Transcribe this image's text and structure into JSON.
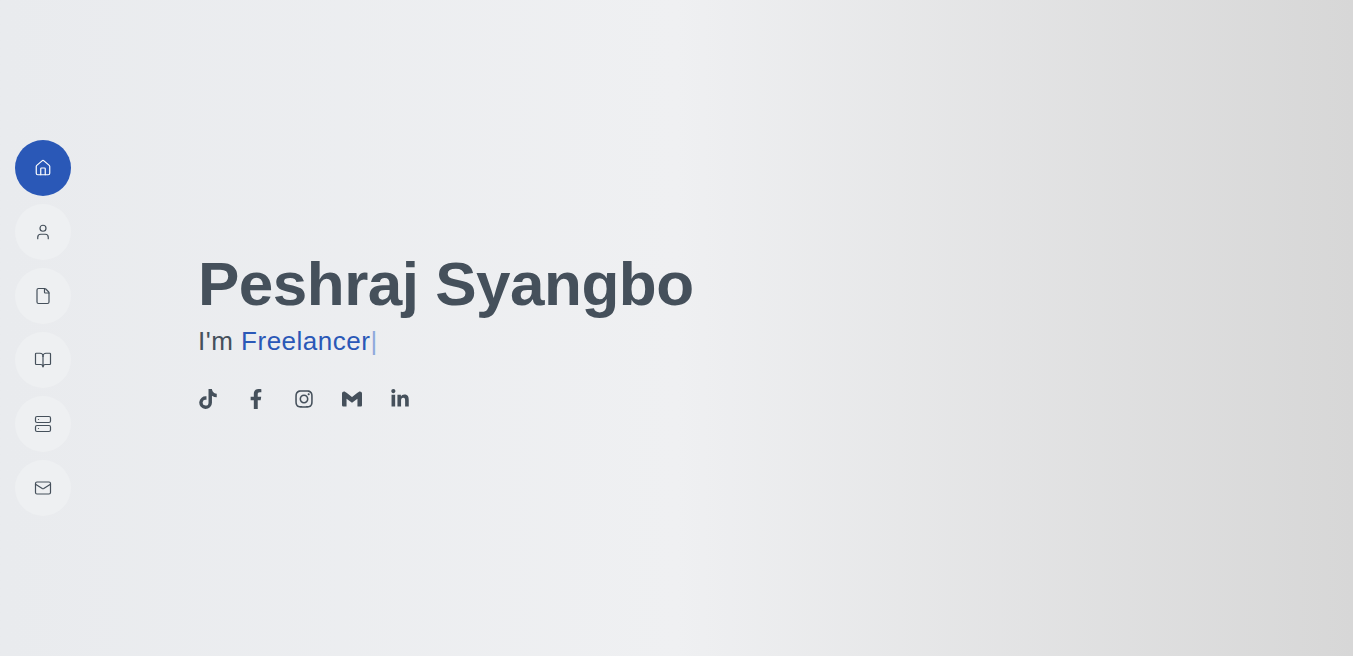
{
  "nav": {
    "items": [
      {
        "selected": true
      },
      {
        "selected": false
      },
      {
        "selected": false
      },
      {
        "selected": false
      },
      {
        "selected": false
      },
      {
        "selected": false
      }
    ]
  },
  "hero": {
    "name": "Peshraj Syangbo",
    "prefix": "I'm",
    "typed": "Freelancer",
    "cursor": "|"
  },
  "socials": {
    "count": 5
  }
}
